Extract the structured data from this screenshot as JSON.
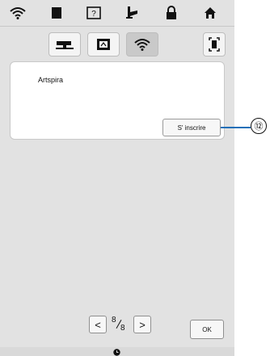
{
  "toolbar": {
    "icons": [
      "wifi-icon",
      "document-icon",
      "help-icon",
      "sewing-icon",
      "lock-icon",
      "home-icon"
    ]
  },
  "tabs": {
    "items": [
      "machine-icon",
      "embroidery-icon",
      "wifi-icon"
    ],
    "active_index": 2
  },
  "panel": {
    "app_label": "Artspira",
    "signup_label": "S' inscrire"
  },
  "callout": {
    "number": "⑫"
  },
  "pagination": {
    "current": "8",
    "total": "8",
    "prev_label": "<",
    "next_label": ">"
  },
  "ok_label": "OK",
  "colors": {
    "background": "#e2e2e2",
    "callout_line": "#1e6fb8"
  }
}
